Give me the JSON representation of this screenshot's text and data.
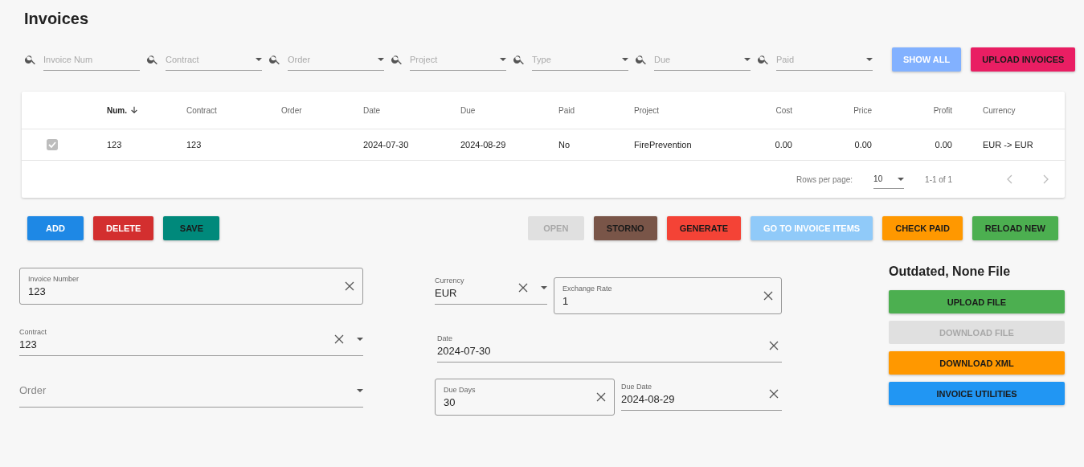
{
  "title": "Invoices",
  "filters": [
    {
      "placeholder": "Invoice Num",
      "dropdown": false
    },
    {
      "placeholder": "Contract",
      "dropdown": true
    },
    {
      "placeholder": "Order",
      "dropdown": true
    },
    {
      "placeholder": "Project",
      "dropdown": true
    },
    {
      "placeholder": "Type",
      "dropdown": true
    },
    {
      "placeholder": "Due",
      "dropdown": true
    },
    {
      "placeholder": "Paid",
      "dropdown": true
    }
  ],
  "header_buttons": [
    {
      "label": "SHOW ALL",
      "color": "#82b1ff",
      "light_label": true
    },
    {
      "label": "UPLOAD INVOICES",
      "color": "#e91e63",
      "light_label": false
    }
  ],
  "table": {
    "columns": [
      {
        "label": "Num.",
        "sorted": true,
        "kind": "text"
      },
      {
        "label": "Contract",
        "sorted": false,
        "kind": "text"
      },
      {
        "label": "Order",
        "sorted": false,
        "kind": "text"
      },
      {
        "label": "Date",
        "sorted": false,
        "kind": "text"
      },
      {
        "label": "Due",
        "sorted": false,
        "kind": "text"
      },
      {
        "label": "Paid",
        "sorted": false,
        "kind": "text"
      },
      {
        "label": "Project",
        "sorted": false,
        "kind": "text"
      },
      {
        "label": "Cost",
        "sorted": false,
        "kind": "number"
      },
      {
        "label": "Price",
        "sorted": false,
        "kind": "number"
      },
      {
        "label": "Profit",
        "sorted": false,
        "kind": "number"
      },
      {
        "label": "Currency",
        "sorted": false,
        "kind": "text"
      }
    ],
    "rows": [
      {
        "checked": true,
        "cells": [
          "123",
          "123",
          "",
          "2024-07-30",
          "2024-08-29",
          "No",
          "FirePrevention",
          "0.00",
          "0.00",
          "0.00",
          "EUR -> EUR"
        ]
      }
    ],
    "footer": {
      "rows_per_page_label": "Rows per page:",
      "rows_per_page": "10",
      "range": "1-1 of 1"
    }
  },
  "actions_left": [
    {
      "label": "ADD",
      "color": "#1e88e5",
      "light_label": true,
      "disabled": false
    },
    {
      "label": "DELETE",
      "color": "#d32f2f",
      "light_label": true,
      "disabled": false
    },
    {
      "label": "SAVE",
      "color": "#00897b",
      "light_label": false,
      "disabled": false
    }
  ],
  "actions_right": [
    {
      "label": "OPEN",
      "color": "#e0e0e0",
      "disabled": true
    },
    {
      "label": "STORNO",
      "color": "#795548",
      "light_label": false,
      "disabled": false
    },
    {
      "label": "GENERATE",
      "color": "#f44336",
      "light_label": false,
      "disabled": false
    },
    {
      "label": "GO TO INVOICE ITEMS",
      "color": "#90caf9",
      "light_label": true,
      "disabled": false
    },
    {
      "label": "CHECK PAID",
      "color": "#ff9800",
      "light_label": false,
      "disabled": false
    },
    {
      "label": "RELOAD NEW",
      "color": "#4caf50",
      "light_label": false,
      "disabled": false
    }
  ],
  "form_left": [
    [
      {
        "kind": "outlined",
        "label": "Invoice Number",
        "value": "123",
        "clearable": true,
        "dropdown": false
      }
    ],
    [
      {
        "kind": "underlined",
        "label": "Contract",
        "value": "123",
        "clearable": true,
        "dropdown": true
      }
    ],
    [
      {
        "kind": "underlined",
        "placeholder": "Order",
        "clearable": false,
        "dropdown": true
      }
    ]
  ],
  "form_middle": [
    [
      {
        "kind": "underlined",
        "label": "Currency",
        "value": "EUR",
        "clearable": true,
        "dropdown": true
      },
      {
        "kind": "outlined",
        "label": "Exchange Rate",
        "value": "1",
        "clearable": true,
        "dropdown": false
      }
    ],
    [
      {
        "kind": "underlined",
        "label": "Date",
        "value": "2024-07-30",
        "clearable": true,
        "dropdown": false
      }
    ],
    [
      {
        "kind": "outlined",
        "label": "Due Days",
        "value": "30",
        "clearable": true,
        "dropdown": false
      },
      {
        "kind": "underlined",
        "label": "Due Date",
        "value": "2024-08-29",
        "clearable": true,
        "dropdown": false
      }
    ]
  ],
  "file_panel": {
    "title": "Outdated, None File",
    "buttons": [
      {
        "label": "UPLOAD FILE",
        "color": "#4caf50",
        "light_label": false,
        "disabled": false
      },
      {
        "label": "DOWNLOAD FILE",
        "color": "#e0e0e0",
        "disabled": true
      },
      {
        "label": "DOWNLOAD XML",
        "color": "#ff9800",
        "light_label": false,
        "disabled": false
      },
      {
        "label": "INVOICE UTILITIES",
        "color": "#2196f3",
        "light_label": false,
        "disabled": false
      }
    ]
  }
}
